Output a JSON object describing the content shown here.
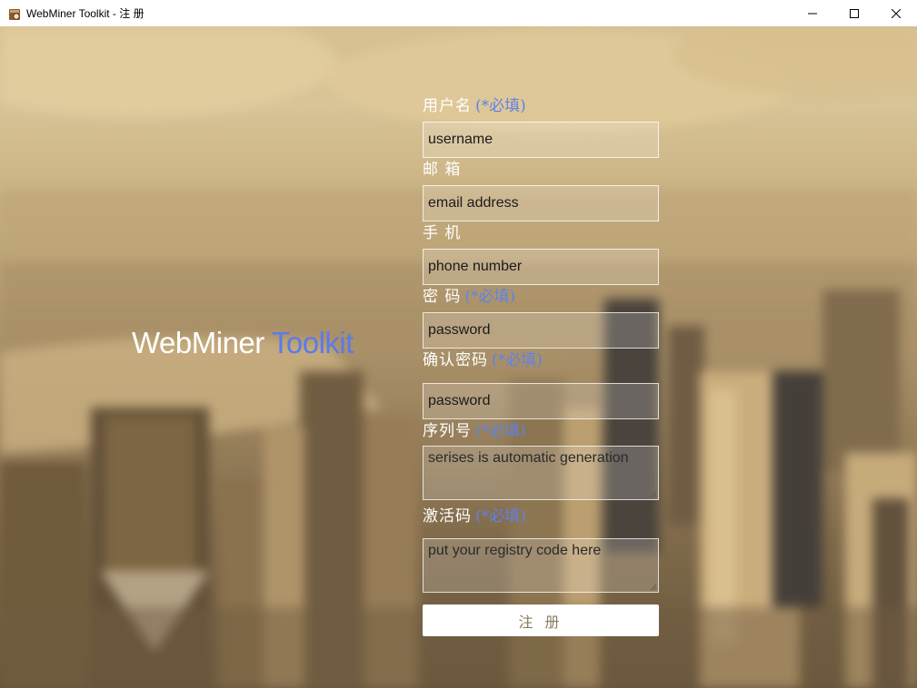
{
  "window": {
    "title": "WebMiner Toolkit - 注 册",
    "icon": "app-icon",
    "controls": [
      "minimize-icon",
      "maximize-icon",
      "close-icon"
    ]
  },
  "brand": {
    "part1": "WebMiner",
    "part2": "Toolkit",
    "accent_color": "#5a7be8"
  },
  "form": {
    "fields": [
      {
        "label": "用户名",
        "required": "(*必填)",
        "placeholder": "username"
      },
      {
        "label": "邮 箱",
        "required": "",
        "placeholder": "email address"
      },
      {
        "label": "手 机",
        "required": "",
        "placeholder": "phone number"
      },
      {
        "label": "密 码",
        "required": "(*必填)",
        "placeholder": "password"
      },
      {
        "label": "确认密码",
        "required": "(*必填)",
        "placeholder": "password"
      },
      {
        "label": "序列号",
        "required": "(*必填)",
        "placeholder": "serises is automatic generation"
      },
      {
        "label": "激活码",
        "required": "(*必填)",
        "placeholder": "put your registry code here"
      }
    ],
    "submit_label": "注 册"
  },
  "colors": {
    "required_text": "#5e82ea",
    "label_text": "#ffffff",
    "button_text": "#8a7a5c"
  }
}
